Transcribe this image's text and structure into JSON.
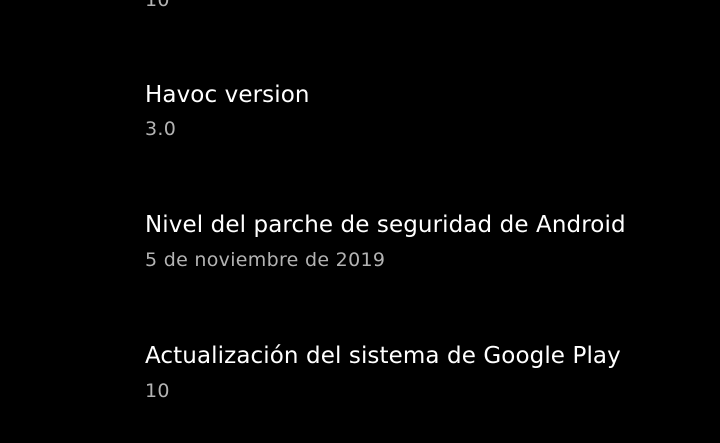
{
  "settings_list": {
    "items": [
      {
        "title": "",
        "summary": "10"
      },
      {
        "title": "Havoc version",
        "summary": "3.0"
      },
      {
        "title": "Nivel del parche de seguridad de Android",
        "summary": "5 de noviembre de 2019"
      },
      {
        "title": "Actualización del sistema de Google Play",
        "summary": "10"
      }
    ]
  },
  "colors": {
    "background": "#000000",
    "title_text": "#ffffff",
    "summary_text": "#b3b3b3"
  }
}
